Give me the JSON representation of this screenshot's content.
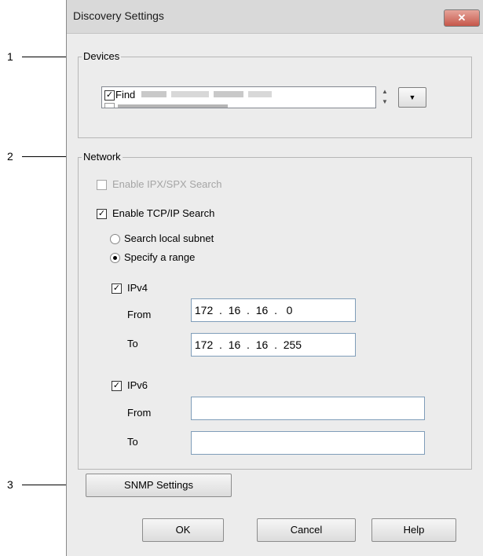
{
  "callouts": [
    "1",
    "2",
    "3"
  ],
  "dialog": {
    "title": "Discovery Settings",
    "close_glyph": "✕"
  },
  "devices": {
    "group_label": "Devices",
    "item_label": "Find",
    "item_checked": true,
    "dropdown_glyph": "▼",
    "spin_up_glyph": "▲",
    "spin_down_glyph": "▼"
  },
  "network": {
    "group_label": "Network",
    "ipx": {
      "label": "Enable IPX/SPX Search",
      "checked": false,
      "enabled": false
    },
    "tcpip": {
      "label": "Enable TCP/IP Search",
      "checked": true
    },
    "radio_local": {
      "label": "Search local subnet",
      "selected": false
    },
    "radio_range": {
      "label": "Specify a range",
      "selected": true
    },
    "ipv4": {
      "label": "IPv4",
      "checked": true,
      "from_label": "From",
      "from_value": " 172  .  16  .  16  .   0",
      "to_label": "To",
      "to_value": " 172  .  16  .  16  .  255"
    },
    "ipv6": {
      "label": "IPv6",
      "checked": true,
      "from_label": "From",
      "from_value": "",
      "to_label": "To",
      "to_value": ""
    }
  },
  "buttons": {
    "snmp": "SNMP Settings",
    "ok": "OK",
    "cancel": "Cancel",
    "help": "Help"
  }
}
